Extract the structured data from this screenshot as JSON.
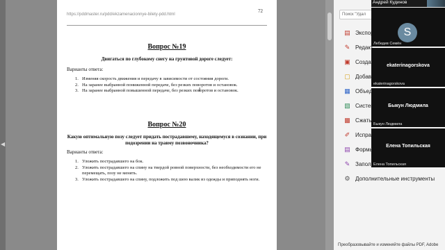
{
  "document": {
    "url": "https://pddmaster.ru/pdd/ekzamenacionnye-bilety-pdd.html",
    "page_number": "72",
    "questions": [
      {
        "title": "Вопрос №19",
        "text": "Двигаться по глубокому снегу на грунтовой дороге следует:",
        "answers_label": "Варианты ответа:",
        "answers": [
          {
            "n": "1.",
            "text": "Изменяя скорость движения и передачу в зависимости от состояния дороги."
          },
          {
            "n": "2.",
            "text": "На заранее выбранной пониженной передаче, без резких поворотов и остановок."
          },
          {
            "n": "3.",
            "text": "На заранее выбранной повышенной передаче, без резких поворотов и остановок."
          }
        ]
      },
      {
        "title": "Вопрос №20",
        "text": "Какую оптимальную позу следует придать пострадавшему, находящемуся в сознании, при подозрении на травму позвоночника?",
        "answers_label": "Варианты ответа:",
        "answers": [
          {
            "n": "1.",
            "text": "Уложить пострадавшего на бок."
          },
          {
            "n": "2.",
            "text": "Уложить пострадавшего на спину на твердой ровной поверхности, без необходимости его не перемещать, позу не менять."
          },
          {
            "n": "3.",
            "text": "Уложить пострадавшего на спину, подложить под шею валик из одежды и приподнять ноги."
          }
        ]
      }
    ]
  },
  "side_panel": {
    "search_placeholder": "Поиск \"Удал",
    "tools": [
      {
        "label": "Экспорт",
        "icon": "export-icon",
        "color": "#c0392b"
      },
      {
        "label": "Редакт",
        "icon": "edit-icon",
        "color": "#c0392b"
      },
      {
        "label": "Создат",
        "icon": "create-icon",
        "color": "#c0392b"
      },
      {
        "label": "Добав",
        "icon": "add-comment-icon",
        "color": "#d4a017"
      },
      {
        "label": "Объед",
        "icon": "combine-icon",
        "color": "#2e64c8"
      },
      {
        "label": "Систем",
        "icon": "organize-icon",
        "color": "#2e8b57"
      },
      {
        "label": "Сжать",
        "icon": "compress-icon",
        "color": "#c0392b"
      },
      {
        "label": "Исправ",
        "icon": "redact-icon",
        "color": "#c0392b"
      },
      {
        "label": "Формы",
        "icon": "forms-icon",
        "color": "#8e44ad"
      },
      {
        "label": "Заполн",
        "icon": "fill-sign-icon",
        "color": "#8e44ad"
      },
      {
        "label": "Дополнительные инструменты",
        "icon": "more-tools-icon",
        "color": "#555555"
      }
    ],
    "bottom_text": "Преобразовывайте и изменяйте файлы PDF, Adobe"
  },
  "participants": {
    "top_name": "Андрей Кудинов",
    "tiles": [
      {
        "name": "Лебедев Семён",
        "avatar_letter": "S",
        "big_label": ""
      },
      {
        "name": "ekaterinagorskova",
        "avatar_letter": "",
        "big_label": "ekaterinagorskova"
      },
      {
        "name": "Быкун Людмила",
        "avatar_letter": "",
        "big_label": "Быкун Людмила"
      },
      {
        "name": "Елена Топильская",
        "avatar_letter": "",
        "big_label": "Елена Топильская"
      }
    ]
  }
}
